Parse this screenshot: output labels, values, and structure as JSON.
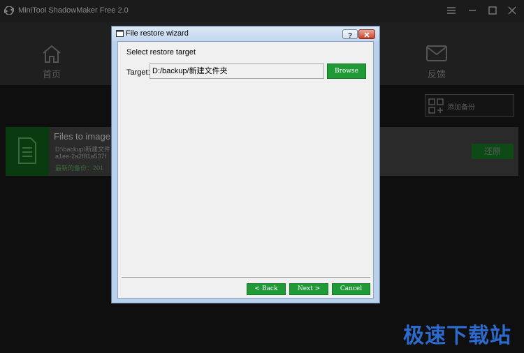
{
  "app": {
    "title": "MiniTool ShadowMaker Free 2.0",
    "nav": [
      {
        "label": "首页",
        "icon": "home-icon"
      },
      {
        "label": "",
        "icon": "tools-icon"
      },
      {
        "label": "",
        "icon": "manage-icon"
      },
      {
        "label": "反馈",
        "icon": "mail-icon"
      }
    ],
    "add_backup_label": "添加备份",
    "task": {
      "title": "Files to image:",
      "line1": "D:\\backup\\新建文件",
      "line2": "a1ee-2a2f81a537f",
      "line3": "最新的备份：201",
      "restore_label": "还原"
    }
  },
  "dialog": {
    "title": "File restore wizard",
    "section_title": "Select restore target",
    "target_label": "Target:",
    "target_value": "D:/backup/新建文件夹",
    "browse_label": "Browse",
    "back_label": "< Back",
    "next_label": "Next >",
    "cancel_label": "Cancel"
  },
  "watermark": "极速下载站",
  "colors": {
    "accent_green": "#1f9a36",
    "dialog_frame": "#b9d1ea",
    "app_background": "#1a1a1a"
  }
}
